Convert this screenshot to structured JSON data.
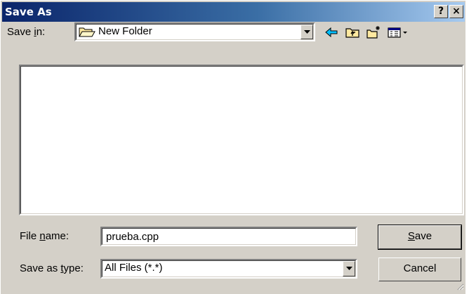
{
  "window": {
    "title": "Save As",
    "help_label": "?",
    "close_label": "×"
  },
  "save_in": {
    "label_pre": "Save ",
    "label_u": "i",
    "label_post": "n:",
    "value": "New Folder",
    "icon": "folder-open-icon"
  },
  "toolbar": {
    "icons": [
      "back-arrow-icon",
      "up-one-level-icon",
      "create-new-folder-icon",
      "view-menu-icon"
    ]
  },
  "file_name": {
    "label_pre": "File ",
    "label_u": "n",
    "label_post": "ame:",
    "value": "prueba.cpp"
  },
  "save_as_type": {
    "label_pre": "Save as ",
    "label_u": "t",
    "label_post": "ype:",
    "value": "All Files (*.*)"
  },
  "buttons": {
    "save_u": "S",
    "save_rest": "ave",
    "cancel": "Cancel"
  },
  "colors": {
    "face": "#d4d0c8",
    "title_start": "#0a246a",
    "title_end": "#a6caf0"
  }
}
